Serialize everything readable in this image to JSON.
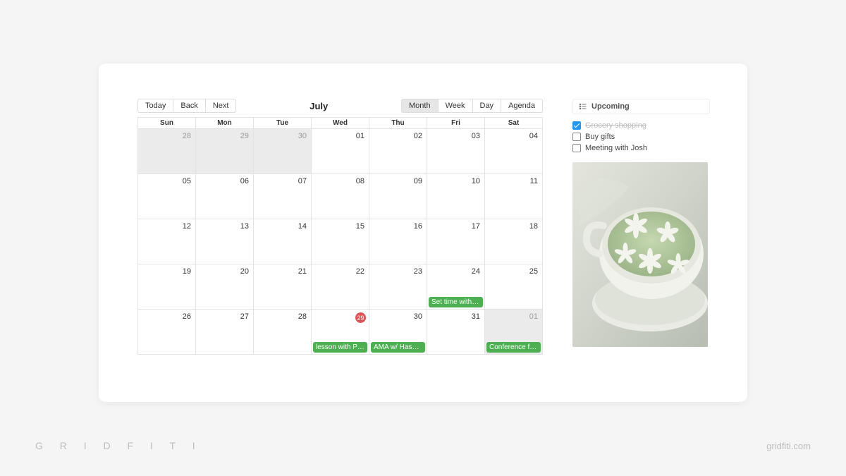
{
  "brand": {
    "mark": "G R I D F I T I",
    "url": "gridfiti.com"
  },
  "calendar": {
    "title": "July",
    "nav": {
      "today": "Today",
      "back": "Back",
      "next": "Next"
    },
    "views": {
      "month": "Month",
      "week": "Week",
      "day": "Day",
      "agenda": "Agenda",
      "active": "month"
    },
    "dows": [
      "Sun",
      "Mon",
      "Tue",
      "Wed",
      "Thu",
      "Fri",
      "Sat"
    ],
    "weeks": [
      [
        {
          "n": "28",
          "off": true
        },
        {
          "n": "29",
          "off": true
        },
        {
          "n": "30",
          "off": true
        },
        {
          "n": "01"
        },
        {
          "n": "02"
        },
        {
          "n": "03"
        },
        {
          "n": "04"
        }
      ],
      [
        {
          "n": "05"
        },
        {
          "n": "06"
        },
        {
          "n": "07"
        },
        {
          "n": "08"
        },
        {
          "n": "09"
        },
        {
          "n": "10"
        },
        {
          "n": "11"
        }
      ],
      [
        {
          "n": "12"
        },
        {
          "n": "13"
        },
        {
          "n": "14"
        },
        {
          "n": "15"
        },
        {
          "n": "16"
        },
        {
          "n": "17"
        },
        {
          "n": "18"
        }
      ],
      [
        {
          "n": "19"
        },
        {
          "n": "20"
        },
        {
          "n": "21"
        },
        {
          "n": "22"
        },
        {
          "n": "23"
        },
        {
          "n": "24",
          "event": "Set time with Li…"
        },
        {
          "n": "25"
        }
      ],
      [
        {
          "n": "26"
        },
        {
          "n": "27"
        },
        {
          "n": "28"
        },
        {
          "n": "29",
          "today": true,
          "event": "lesson with Prof…"
        },
        {
          "n": "30",
          "event": "AMA w/ Hasque…"
        },
        {
          "n": "31"
        },
        {
          "n": "01",
          "off": true,
          "event": "Conference for …"
        }
      ]
    ]
  },
  "sidebar": {
    "heading": "Upcoming",
    "tasks": [
      {
        "label": "Grocery shopping",
        "done": true
      },
      {
        "label": "Buy gifts",
        "done": false
      },
      {
        "label": "Meeting with Josh",
        "done": false
      }
    ]
  }
}
